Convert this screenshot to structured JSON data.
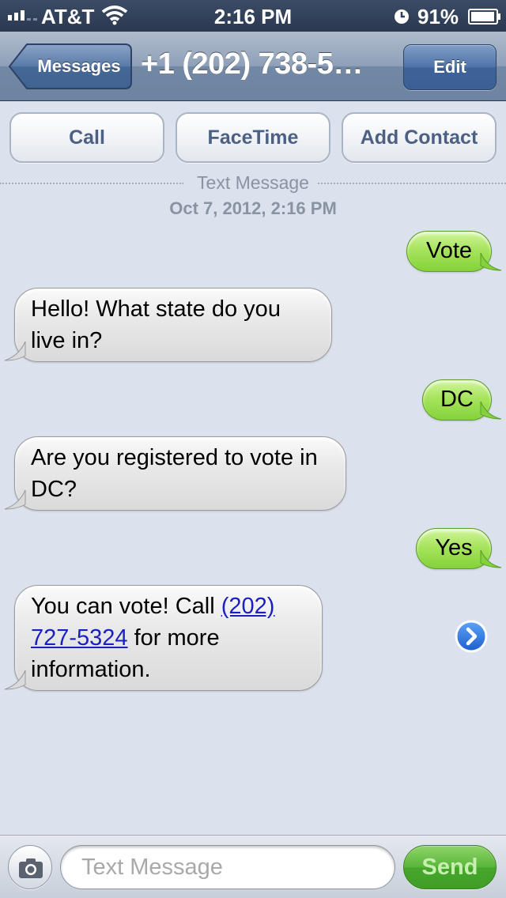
{
  "status_bar": {
    "carrier": "AT&T",
    "time": "2:16 PM",
    "battery_percent": "91%",
    "signal_bars": 3,
    "icons": [
      "signal-icon",
      "wifi-icon",
      "alarm-icon",
      "battery-icon"
    ]
  },
  "nav": {
    "back_label": "Messages",
    "title": "+1 (202) 738-5…",
    "edit_label": "Edit"
  },
  "actions": {
    "call_label": "Call",
    "facetime_label": "FaceTime",
    "add_contact_label": "Add Contact"
  },
  "conversation": {
    "type_label": "Text Message",
    "date": "Oct 7, 2012, 2:16 PM",
    "messages": [
      {
        "direction": "sent",
        "text": "Vote"
      },
      {
        "direction": "received",
        "text": "Hello! What state do you live in?"
      },
      {
        "direction": "sent",
        "text": "DC"
      },
      {
        "direction": "received",
        "text": "Are you registered to vote in DC?"
      },
      {
        "direction": "sent",
        "text": "Yes"
      },
      {
        "direction": "received",
        "text_before": "You can vote! Call ",
        "link": "(202) 727-5324",
        "text_after": " for more information."
      }
    ]
  },
  "input_bar": {
    "placeholder": "Text Message",
    "send_label": "Send"
  },
  "colors": {
    "background": "#dbe2ed",
    "sent_bubble": "#a7e45d",
    "received_bubble": "#e9e9e9",
    "link": "#1a1fc2",
    "nav_bar": "#8ea0b8",
    "send_button": "#59b63a"
  }
}
